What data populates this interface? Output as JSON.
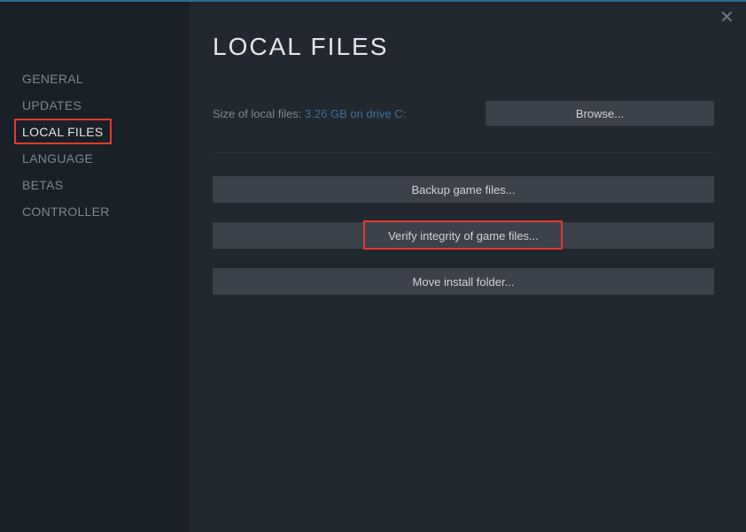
{
  "sidebar": {
    "items": [
      {
        "label": "GENERAL"
      },
      {
        "label": "UPDATES"
      },
      {
        "label": "LOCAL FILES"
      },
      {
        "label": "LANGUAGE"
      },
      {
        "label": "BETAS"
      },
      {
        "label": "CONTROLLER"
      }
    ]
  },
  "main": {
    "title": "LOCAL FILES",
    "size_label": "Size of local files: ",
    "size_value": "3.26 GB on drive C:",
    "browse_label": "Browse...",
    "backup_label": "Backup game files...",
    "verify_label": "Verify integrity of game files...",
    "move_label": "Move install folder..."
  }
}
